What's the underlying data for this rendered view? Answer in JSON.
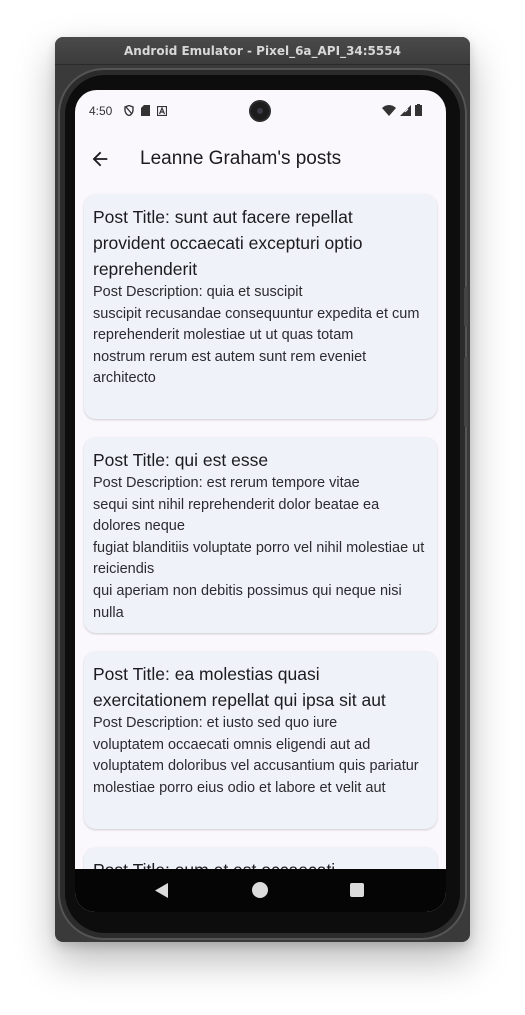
{
  "window": {
    "title": "Android Emulator - Pixel_6a_API_34:5554"
  },
  "status_bar": {
    "time": "4:50",
    "left_icons": [
      "vpn-shield-icon",
      "sd-card-icon",
      "notification-a-icon"
    ],
    "right_icons": [
      "wifi-icon",
      "cell-signal-icon",
      "battery-icon"
    ]
  },
  "app_bar": {
    "title": "Leanne Graham's posts",
    "back_icon": "arrow-back-icon"
  },
  "posts": [
    {
      "title": "Post Title: sunt aut facere repellat provident occaecati excepturi optio reprehenderit",
      "description": "Post Description: quia et suscipit\nsuscipit recusandae consequuntur expedita et cum\nreprehenderit molestiae ut ut quas totam\nnostrum rerum est autem sunt rem eveniet architecto"
    },
    {
      "title": "Post Title: qui est esse",
      "description": "Post Description: est rerum tempore vitae\nsequi sint nihil reprehenderit dolor beatae ea dolores neque\nfugiat blanditiis voluptate porro vel nihil molestiae ut reiciendis\nqui aperiam non debitis possimus qui neque nisi nulla"
    },
    {
      "title": "Post Title: ea molestias quasi exercitationem repellat qui ipsa sit aut",
      "description": "Post Description: et iusto sed quo iure\nvoluptatem occaecati omnis eligendi aut ad\nvoluptatem doloribus vel accusantium quis pariatur\nmolestiae porro eius odio et labore et velit aut"
    },
    {
      "title": "Post Title: eum et est occaecati",
      "description": ""
    }
  ],
  "nav_bar": {
    "icons": [
      "nav-back-icon",
      "nav-home-icon",
      "nav-recents-icon"
    ]
  },
  "colors": {
    "card_bg": "#eff2f9",
    "screen_bg": "#fbf8fd",
    "text": "#1c1b1f"
  }
}
